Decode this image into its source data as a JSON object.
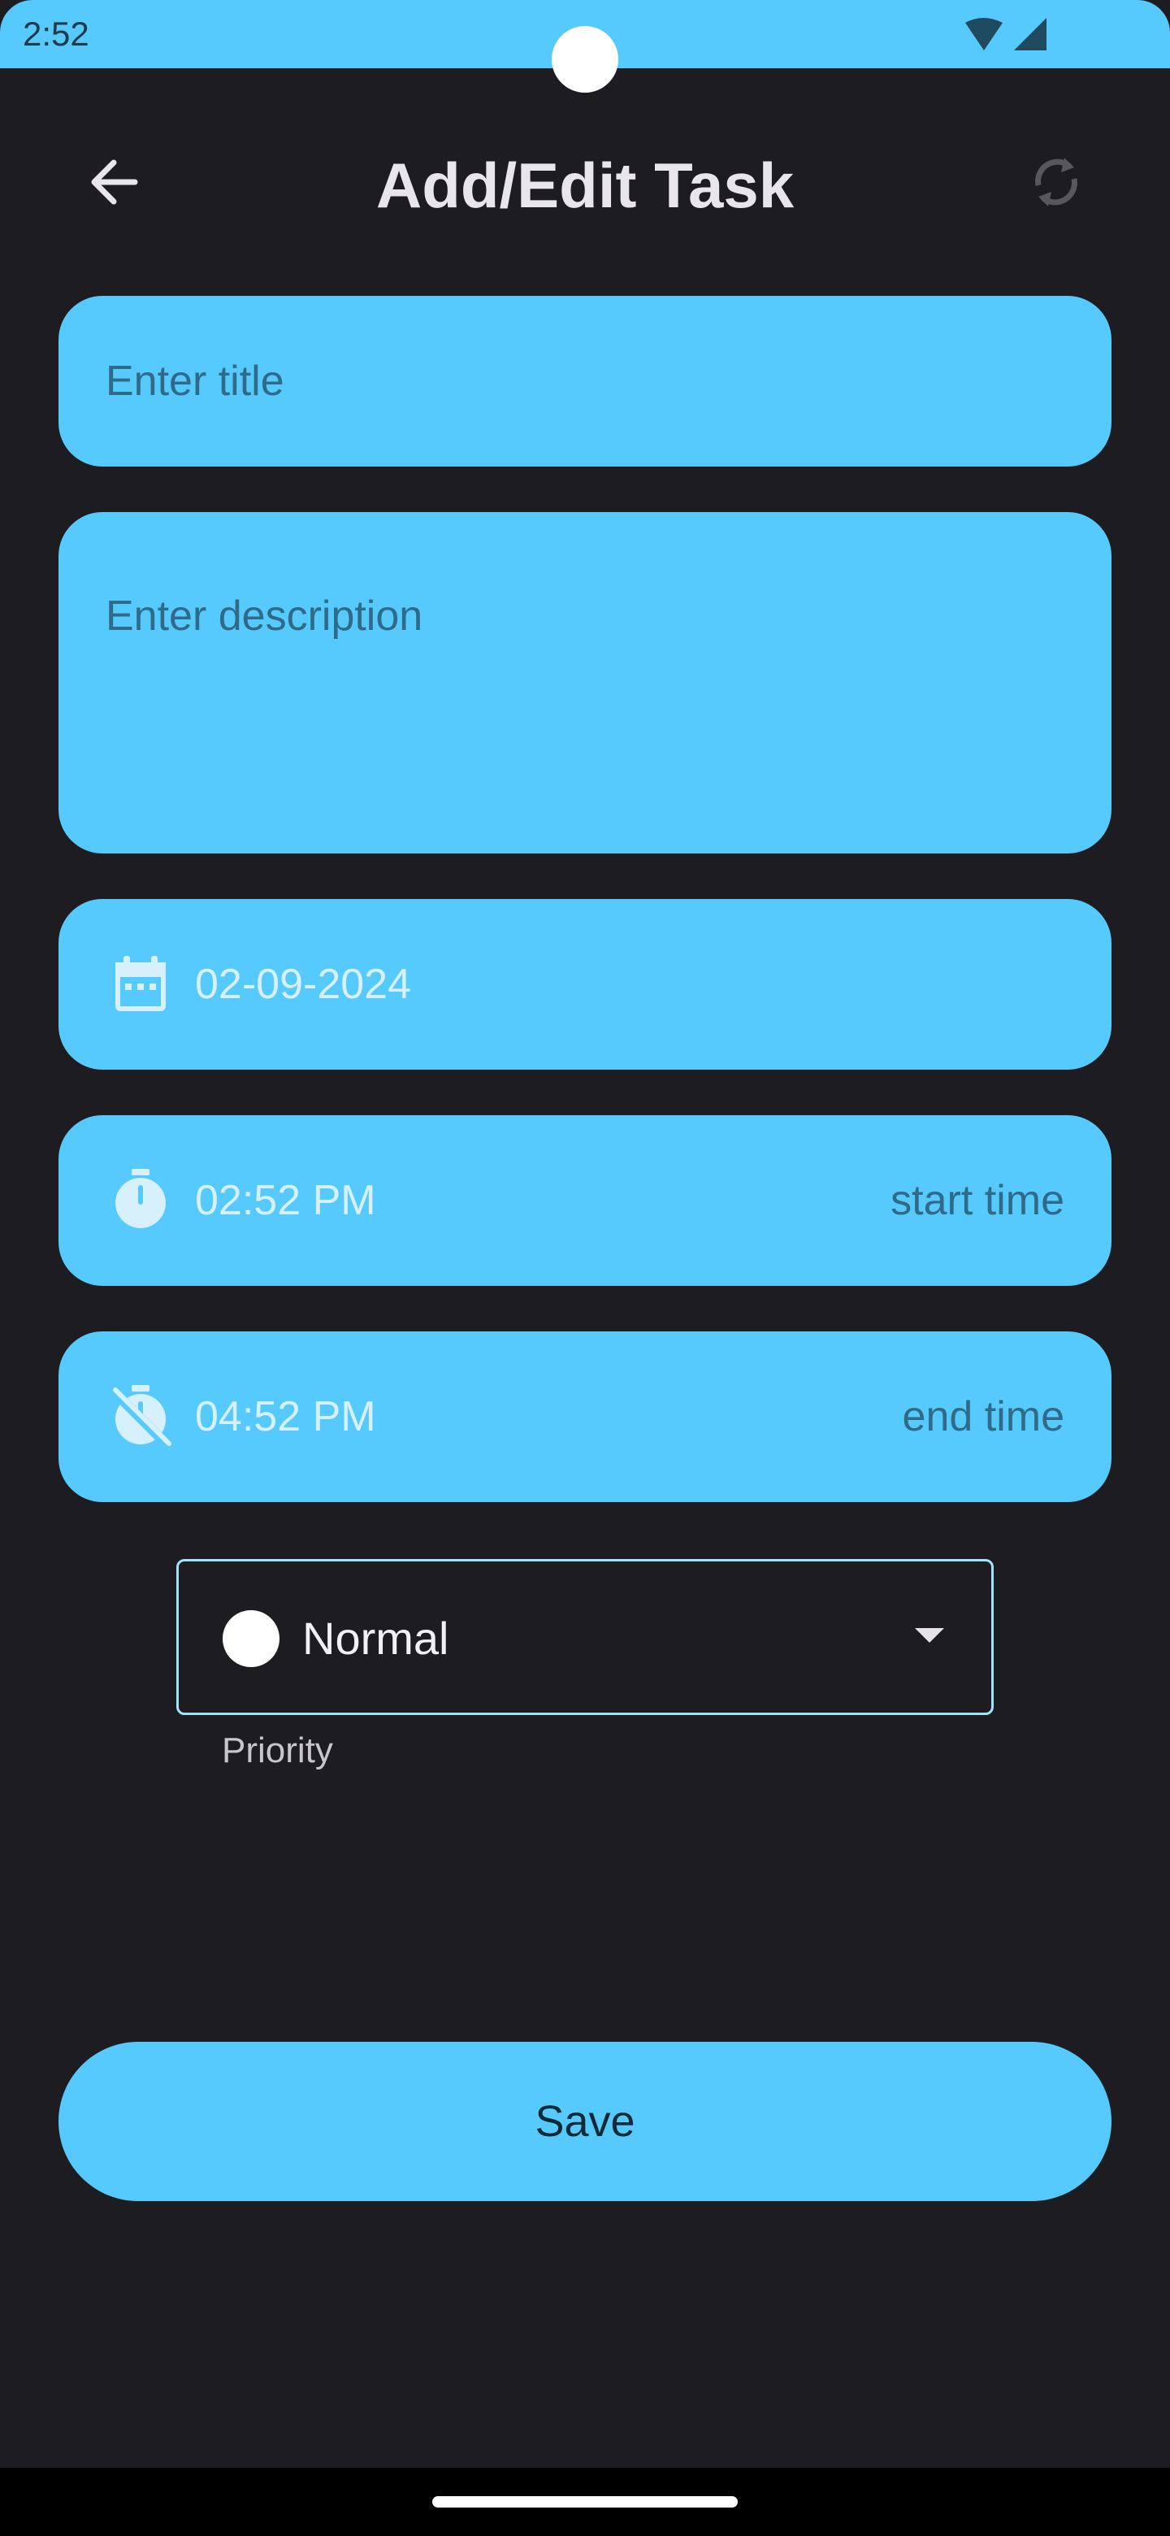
{
  "status_bar": {
    "time": "2:52",
    "background": "#56c9fd",
    "icons": [
      "wifi-icon",
      "signal-icon"
    ]
  },
  "header": {
    "title": "Add/Edit Task",
    "back_icon": "arrow-back-icon",
    "refresh_icon": "refresh-icon"
  },
  "form": {
    "title_field": {
      "value": "",
      "placeholder": "Enter title"
    },
    "description_field": {
      "value": "",
      "placeholder": "Enter description"
    },
    "date_field": {
      "icon": "calendar-icon",
      "value": "02-09-2024"
    },
    "start_time_field": {
      "icon": "timer-icon",
      "value": "02:52 PM",
      "hint": "start time"
    },
    "end_time_field": {
      "icon": "timer-off-icon",
      "value": "04:52 PM",
      "hint": "end time"
    },
    "priority": {
      "value": "Normal",
      "label": "Priority",
      "dot_color": "#ffffff"
    },
    "save_label": "Save"
  },
  "colors": {
    "accent": "#56c9fd",
    "background": "#1d1c21",
    "placeholder_text": "#2f6b88",
    "value_text": "#d6f0fc"
  }
}
